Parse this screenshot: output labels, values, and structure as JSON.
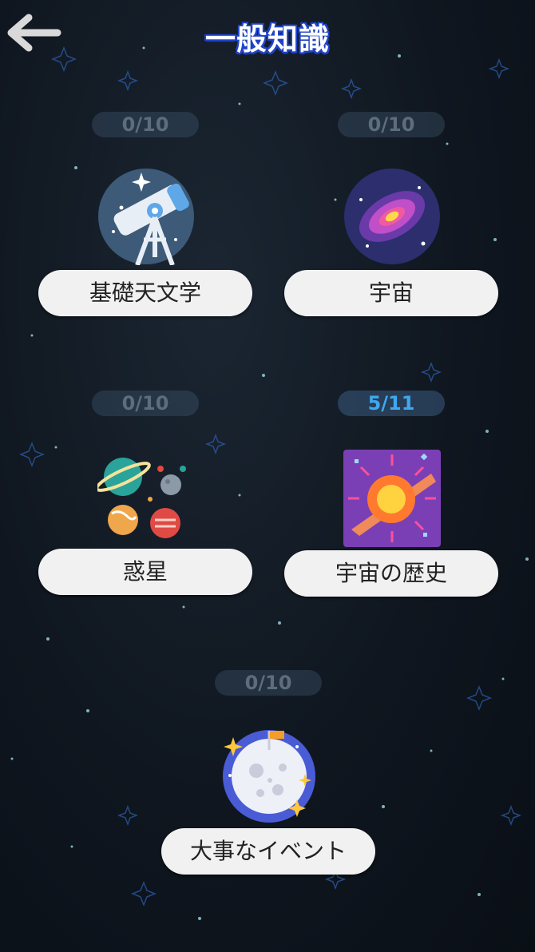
{
  "header": {
    "title": "一般知識"
  },
  "topics": [
    {
      "label": "基礎天文学",
      "score": "0/10",
      "icon": "telescope-icon"
    },
    {
      "label": "宇宙",
      "score": "0/10",
      "icon": "galaxy-icon"
    },
    {
      "label": "惑星",
      "score": "0/10",
      "icon": "planets-icon"
    },
    {
      "label": "宇宙の歴史",
      "score": "5/11",
      "icon": "big-bang-icon"
    },
    {
      "label": "大事なイベント",
      "score": "0/10",
      "icon": "moon-landing-icon"
    }
  ],
  "colors": {
    "title_outline": "#2146d0",
    "score_active": "#3fa8f0",
    "score_inactive": "#5d6d7c",
    "button_bg": "#f1f1f1"
  }
}
